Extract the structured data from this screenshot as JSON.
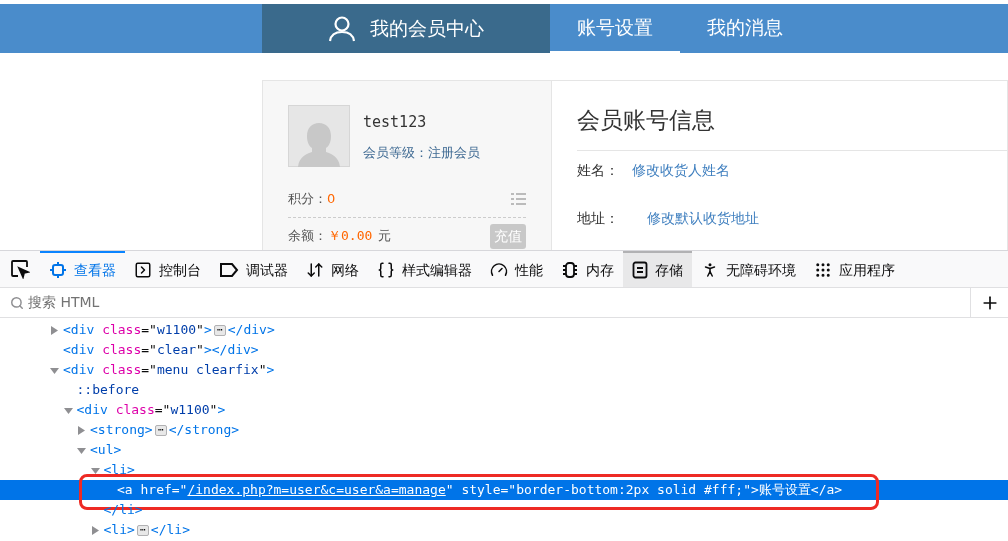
{
  "site_nav": {
    "items": [
      {
        "kind": "home",
        "label": "我的会员中心"
      },
      {
        "kind": "tab",
        "label": "账号设置",
        "selected": true
      },
      {
        "kind": "tab",
        "label": "我的消息",
        "selected": false
      }
    ]
  },
  "profile": {
    "username": "test123",
    "level": "会员等级：注册会员",
    "points_label": "积分：",
    "points": "0",
    "balance_label": "余额：",
    "balance": "￥0.00",
    "balance_unit": "元",
    "recharge_button": "充值"
  },
  "account_info": {
    "title": "会员账号信息",
    "fields": [
      {
        "label": "姓名：",
        "link": "修改收货人姓名"
      },
      {
        "label": "地址：",
        "link": "修改默认收货地址"
      }
    ]
  },
  "devtools": {
    "tabs": [
      {
        "label": "查看器",
        "selected": true,
        "hovered": false
      },
      {
        "label": "控制台",
        "selected": false,
        "hovered": false
      },
      {
        "label": "调试器",
        "selected": false,
        "hovered": false
      },
      {
        "label": "网络",
        "selected": false,
        "hovered": false
      },
      {
        "label": "样式编辑器",
        "selected": false,
        "hovered": false
      },
      {
        "label": "性能",
        "selected": false,
        "hovered": false
      },
      {
        "label": "内存",
        "selected": false,
        "hovered": false
      },
      {
        "label": "存储",
        "selected": false,
        "hovered": true
      },
      {
        "label": "无障碍环境",
        "selected": false,
        "hovered": false
      },
      {
        "label": "应用程序",
        "selected": false,
        "hovered": false
      }
    ],
    "search": {
      "placeholder": "搜索 HTML"
    },
    "tree": [
      {
        "expanded": false,
        "selected": false,
        "outlined": false,
        "parts": [
          {
            "kind": "tag",
            "text": "<div "
          },
          {
            "kind": "attr",
            "text": "class"
          },
          {
            "kind": "plain",
            "text": "=\""
          },
          {
            "kind": "value",
            "text": "w1100"
          },
          {
            "kind": "plain",
            "text": "\""
          },
          {
            "kind": "tag",
            "text": ">"
          },
          {
            "kind": "badge",
            "text": "⋯"
          },
          {
            "kind": "tag",
            "text": "</div>"
          }
        ]
      },
      {
        "selected": false,
        "outlined": false,
        "parts": [
          {
            "kind": "tag",
            "text": "<div "
          },
          {
            "kind": "attr",
            "text": "class"
          },
          {
            "kind": "plain",
            "text": "=\""
          },
          {
            "kind": "value",
            "text": "clear"
          },
          {
            "kind": "plain",
            "text": "\""
          },
          {
            "kind": "tag",
            "text": "></div>"
          }
        ]
      },
      {
        "expanded": true,
        "selected": false,
        "outlined": false,
        "parts": [
          {
            "kind": "tag",
            "text": "<div "
          },
          {
            "kind": "attr",
            "text": "class"
          },
          {
            "kind": "plain",
            "text": "=\""
          },
          {
            "kind": "value",
            "text": "menu clearfix"
          },
          {
            "kind": "plain",
            "text": "\""
          },
          {
            "kind": "tag",
            "text": ">"
          }
        ],
        "children": [
          {
            "selected": false,
            "outlined": false,
            "parts": [
              {
                "kind": "pseudo",
                "text": "::before"
              }
            ]
          },
          {
            "expanded": true,
            "selected": false,
            "outlined": false,
            "parts": [
              {
                "kind": "tag",
                "text": "<div "
              },
              {
                "kind": "attr",
                "text": "class"
              },
              {
                "kind": "plain",
                "text": "=\""
              },
              {
                "kind": "value",
                "text": "w1100"
              },
              {
                "kind": "plain",
                "text": "\""
              },
              {
                "kind": "tag",
                "text": ">"
              }
            ],
            "children": [
              {
                "expanded": false,
                "selected": false,
                "outlined": false,
                "parts": [
                  {
                    "kind": "tag",
                    "text": "<strong>"
                  },
                  {
                    "kind": "badge",
                    "text": "⋯"
                  },
                  {
                    "kind": "tag",
                    "text": "</strong>"
                  }
                ]
              },
              {
                "expanded": true,
                "selected": false,
                "outlined": false,
                "parts": [
                  {
                    "kind": "tag",
                    "text": "<ul>"
                  }
                ],
                "children": [
                  {
                    "expanded": true,
                    "selected": false,
                    "outlined": false,
                    "parts": [
                      {
                        "kind": "tag",
                        "text": "<li>"
                      }
                    ],
                    "closing": [
                      {
                        "kind": "tag",
                        "text": "</li>"
                      }
                    ],
                    "children": [
                      {
                        "selected": true,
                        "outlined": true,
                        "parts": [
                          {
                            "kind": "tag",
                            "text": "<a "
                          },
                          {
                            "kind": "attr",
                            "text": "href"
                          },
                          {
                            "kind": "plain",
                            "text": "=\""
                          },
                          {
                            "kind": "link",
                            "text": "/index.php?m=user&c=user&a=manage"
                          },
                          {
                            "kind": "plain",
                            "text": "\" "
                          },
                          {
                            "kind": "attr",
                            "text": "style"
                          },
                          {
                            "kind": "plain",
                            "text": "=\""
                          },
                          {
                            "kind": "value",
                            "text": "border-bottom:2px solid #fff;"
                          },
                          {
                            "kind": "plain",
                            "text": "\""
                          },
                          {
                            "kind": "tag",
                            "text": ">"
                          },
                          {
                            "kind": "text",
                            "text": "账号设置"
                          },
                          {
                            "kind": "tag",
                            "text": "</a>"
                          }
                        ]
                      }
                    ]
                  },
                  {
                    "expanded": false,
                    "selected": false,
                    "outlined": false,
                    "parts": [
                      {
                        "kind": "tag",
                        "text": "<li>"
                      },
                      {
                        "kind": "badge",
                        "text": "⋯"
                      },
                      {
                        "kind": "tag",
                        "text": "</li>"
                      }
                    ]
                  }
                ]
              }
            ]
          }
        ]
      }
    ]
  }
}
